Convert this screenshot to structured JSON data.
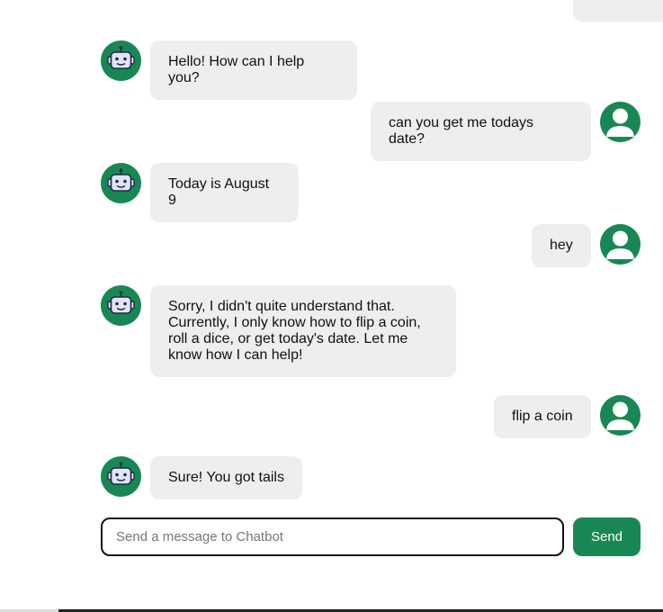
{
  "colors": {
    "accent": "#198754",
    "bubble_bg": "#eeeeee",
    "text": "#111111"
  },
  "messages": [
    {
      "sender": "bot",
      "avatar_icon": "robot-icon",
      "text": "Hello! How can I help you?"
    },
    {
      "sender": "user",
      "avatar_icon": "user-icon",
      "text": "can you get me todays date?"
    },
    {
      "sender": "bot",
      "avatar_icon": "robot-icon",
      "text": "Today is August 9"
    },
    {
      "sender": "user",
      "avatar_icon": "user-icon",
      "text": "hey"
    },
    {
      "sender": "bot",
      "avatar_icon": "robot-icon",
      "text": "Sorry, I didn't quite understand that. Currently, I only know how to flip a coin, roll a dice, or get today's date. Let me know how I can help!"
    },
    {
      "sender": "user",
      "avatar_icon": "user-icon",
      "text": "flip a coin"
    },
    {
      "sender": "bot",
      "avatar_icon": "robot-icon",
      "text": "Sure! You got tails"
    }
  ],
  "composer": {
    "placeholder": "Send a message to Chatbot",
    "value": "",
    "send_label": "Send"
  }
}
